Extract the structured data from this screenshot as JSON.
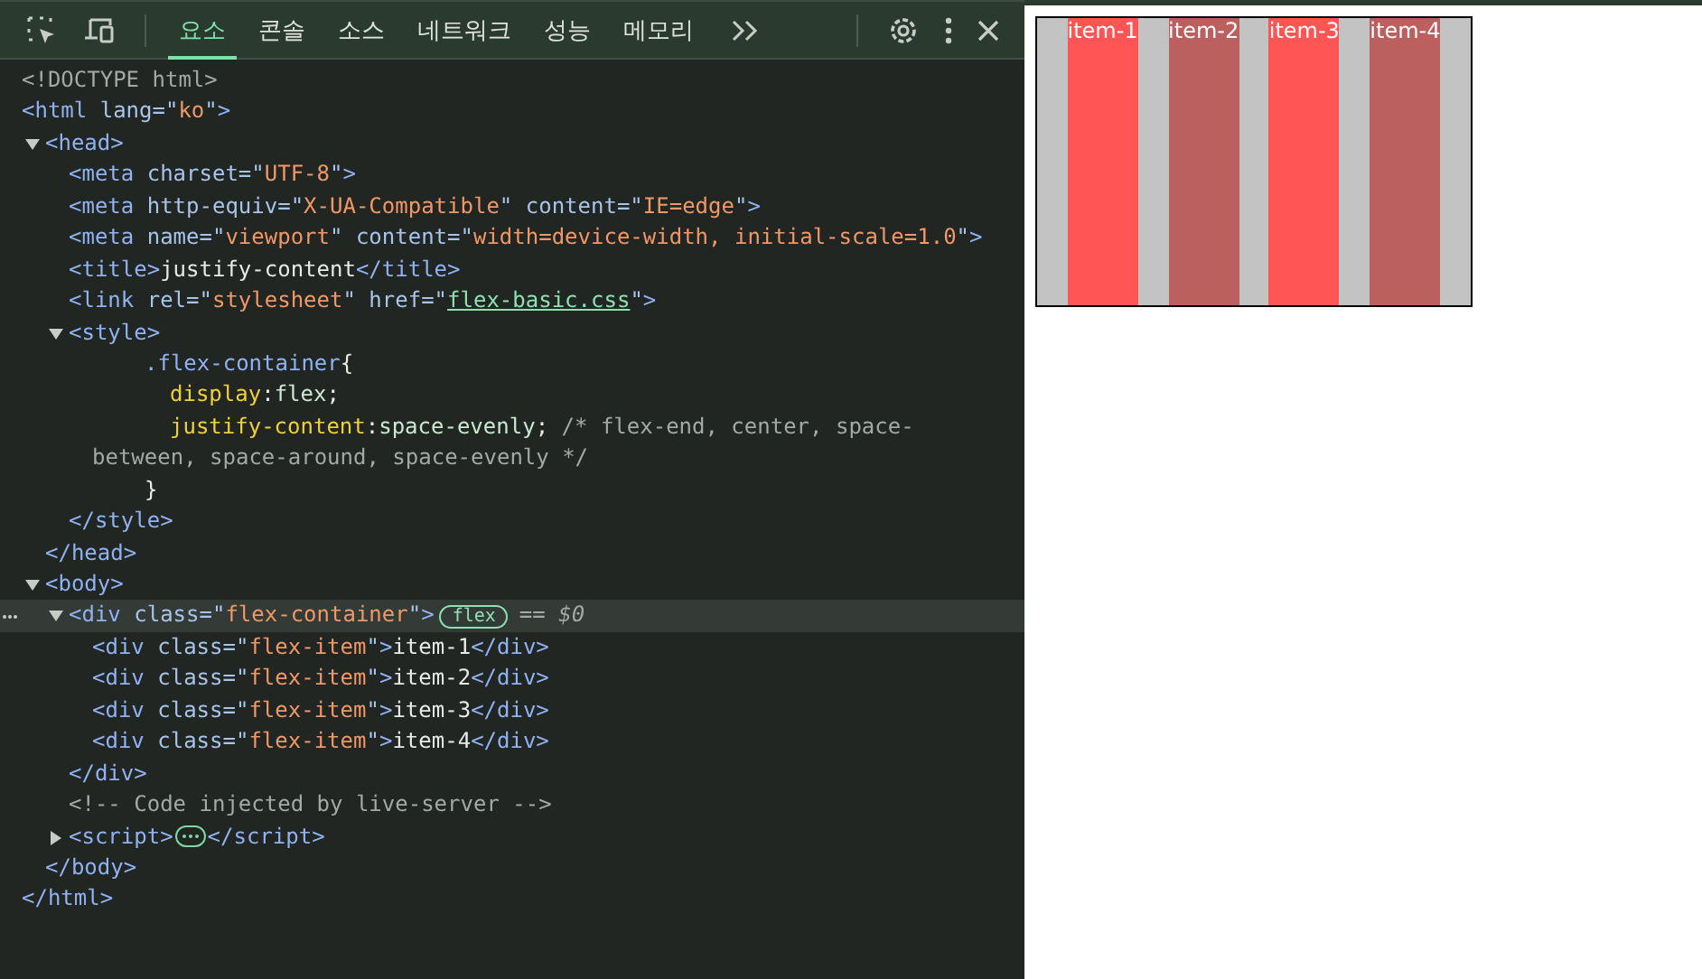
{
  "toolbar": {
    "tabs": [
      {
        "label": "요소",
        "selected": true
      },
      {
        "label": "콘솔",
        "selected": false
      },
      {
        "label": "소스",
        "selected": false
      },
      {
        "label": "네트워크",
        "selected": false
      },
      {
        "label": "성능",
        "selected": false
      },
      {
        "label": "메모리",
        "selected": false
      }
    ]
  },
  "tree": [
    {
      "selected": false,
      "tokens": [
        {
          "kind": "comment",
          "text": "<!DOCTYPE html>"
        }
      ]
    },
    {
      "selected": false,
      "tokens": [
        {
          "kind": "tag",
          "text": "<html"
        },
        {
          "kind": "attr",
          "text": " lang=\""
        },
        {
          "kind": "val",
          "text": "ko"
        },
        {
          "kind": "attr",
          "text": "\""
        },
        {
          "kind": "tag",
          "text": ">"
        }
      ],
      "children": [
        {
          "selected": false,
          "expanded": true,
          "tokens": [
            {
              "kind": "tag",
              "text": "<head>"
            }
          ],
          "children": [
            {
              "selected": false,
              "tokens": [
                {
                  "kind": "tag",
                  "text": "<meta"
                },
                {
                  "kind": "attr",
                  "text": " charset=\""
                },
                {
                  "kind": "val",
                  "text": "UTF-8"
                },
                {
                  "kind": "attr",
                  "text": "\""
                },
                {
                  "kind": "tag",
                  "text": ">"
                }
              ]
            },
            {
              "selected": false,
              "tokens": [
                {
                  "kind": "tag",
                  "text": "<meta"
                },
                {
                  "kind": "attr",
                  "text": " http-equiv=\""
                },
                {
                  "kind": "val",
                  "text": "X-UA-Compatible"
                },
                {
                  "kind": "attr",
                  "text": "\" content=\""
                },
                {
                  "kind": "val",
                  "text": "IE=edge"
                },
                {
                  "kind": "attr",
                  "text": "\""
                },
                {
                  "kind": "tag",
                  "text": ">"
                }
              ]
            },
            {
              "selected": false,
              "tokens": [
                {
                  "kind": "tag",
                  "text": "<meta"
                },
                {
                  "kind": "attr",
                  "text": " name=\""
                },
                {
                  "kind": "val",
                  "text": "viewport"
                },
                {
                  "kind": "attr",
                  "text": "\" content=\""
                },
                {
                  "kind": "val",
                  "text": "width=device-width, initial-scale=1.0"
                },
                {
                  "kind": "attr",
                  "text": "\""
                },
                {
                  "kind": "tag",
                  "text": ">"
                }
              ]
            },
            {
              "selected": false,
              "tokens": [
                {
                  "kind": "tag",
                  "text": "<title>"
                },
                {
                  "kind": "text",
                  "text": "justify-content"
                },
                {
                  "kind": "tag",
                  "text": "</title>"
                }
              ]
            },
            {
              "selected": false,
              "tokens": [
                {
                  "kind": "tag",
                  "text": "<link"
                },
                {
                  "kind": "attr",
                  "text": " rel=\""
                },
                {
                  "kind": "val",
                  "text": "stylesheet"
                },
                {
                  "kind": "attr",
                  "text": "\" href=\""
                },
                {
                  "kind": "link",
                  "text": "flex-basic.css"
                },
                {
                  "kind": "attr",
                  "text": "\""
                },
                {
                  "kind": "tag",
                  "text": ">"
                }
              ]
            },
            {
              "selected": false,
              "expanded": true,
              "tokens": [
                {
                  "kind": "tag",
                  "text": "<style>"
                }
              ],
              "children": [
                {
                  "selected": false,
                  "kind": "css-open",
                  "tokens": [
                    {
                      "kind": "selector",
                      "text": ".flex-container"
                    },
                    {
                      "kind": "text",
                      "text": "{"
                    }
                  ]
                },
                {
                  "selected": false,
                  "kind": "css-decl",
                  "tokens": [
                    {
                      "kind": "prop",
                      "text": "display"
                    },
                    {
                      "kind": "text",
                      "text": ":"
                    },
                    {
                      "kind": "cssval",
                      "text": "flex"
                    },
                    {
                      "kind": "text",
                      "text": ";"
                    }
                  ]
                },
                {
                  "selected": false,
                  "kind": "css-decl",
                  "tokens": [
                    {
                      "kind": "prop",
                      "text": "justify-content"
                    },
                    {
                      "kind": "text",
                      "text": ":"
                    },
                    {
                      "kind": "cssval",
                      "text": "space-evenly"
                    },
                    {
                      "kind": "text",
                      "text": "; "
                    },
                    {
                      "kind": "comment",
                      "text": "/* flex-end, center, space-"
                    }
                  ]
                },
                {
                  "selected": false,
                  "kind": "css-wrap",
                  "tokens": [
                    {
                      "kind": "comment",
                      "text": "between, space-around, space-evenly */"
                    }
                  ]
                },
                {
                  "selected": false,
                  "kind": "css-close",
                  "tokens": [
                    {
                      "kind": "text",
                      "text": "}"
                    }
                  ]
                }
              ]
            },
            {
              "selected": false,
              "tokens": [
                {
                  "kind": "tag",
                  "text": "</style>"
                }
              ]
            }
          ]
        },
        {
          "selected": false,
          "tokens": [
            {
              "kind": "tag",
              "text": "</head>"
            }
          ]
        },
        {
          "selected": false,
          "expanded": true,
          "tokens": [
            {
              "kind": "tag",
              "text": "<body>"
            }
          ],
          "children": [
            {
              "selected": true,
              "expanded": true,
              "badge": "flex",
              "tokens": [
                {
                  "kind": "tag",
                  "text": "<div"
                },
                {
                  "kind": "attr",
                  "text": " class=\""
                },
                {
                  "kind": "val",
                  "text": "flex-container"
                },
                {
                  "kind": "attr",
                  "text": "\""
                },
                {
                  "kind": "tag",
                  "text": ">"
                }
              ],
              "suffix": "== $0",
              "children": [
                {
                  "selected": false,
                  "tokens": [
                    {
                      "kind": "tag",
                      "text": "<div"
                    },
                    {
                      "kind": "attr",
                      "text": " class=\""
                    },
                    {
                      "kind": "val",
                      "text": "flex-item"
                    },
                    {
                      "kind": "attr",
                      "text": "\""
                    },
                    {
                      "kind": "tag",
                      "text": ">"
                    },
                    {
                      "kind": "text",
                      "text": "item-1"
                    },
                    {
                      "kind": "tag",
                      "text": "</div>"
                    }
                  ]
                },
                {
                  "selected": false,
                  "tokens": [
                    {
                      "kind": "tag",
                      "text": "<div"
                    },
                    {
                      "kind": "attr",
                      "text": " class=\""
                    },
                    {
                      "kind": "val",
                      "text": "flex-item"
                    },
                    {
                      "kind": "attr",
                      "text": "\""
                    },
                    {
                      "kind": "tag",
                      "text": ">"
                    },
                    {
                      "kind": "text",
                      "text": "item-2"
                    },
                    {
                      "kind": "tag",
                      "text": "</div>"
                    }
                  ]
                },
                {
                  "selected": false,
                  "tokens": [
                    {
                      "kind": "tag",
                      "text": "<div"
                    },
                    {
                      "kind": "attr",
                      "text": " class=\""
                    },
                    {
                      "kind": "val",
                      "text": "flex-item"
                    },
                    {
                      "kind": "attr",
                      "text": "\""
                    },
                    {
                      "kind": "tag",
                      "text": ">"
                    },
                    {
                      "kind": "text",
                      "text": "item-3"
                    },
                    {
                      "kind": "tag",
                      "text": "</div>"
                    }
                  ]
                },
                {
                  "selected": false,
                  "tokens": [
                    {
                      "kind": "tag",
                      "text": "<div"
                    },
                    {
                      "kind": "attr",
                      "text": " class=\""
                    },
                    {
                      "kind": "val",
                      "text": "flex-item"
                    },
                    {
                      "kind": "attr",
                      "text": "\""
                    },
                    {
                      "kind": "tag",
                      "text": ">"
                    },
                    {
                      "kind": "text",
                      "text": "item-4"
                    },
                    {
                      "kind": "tag",
                      "text": "</div>"
                    }
                  ]
                }
              ]
            },
            {
              "selected": false,
              "tokens": [
                {
                  "kind": "tag",
                  "text": "</div>"
                }
              ]
            },
            {
              "selected": false,
              "tokens": [
                {
                  "kind": "comment",
                  "text": "<!-- Code injected by live-server -->"
                }
              ]
            },
            {
              "selected": false,
              "expanded": false,
              "collapsed_content": true,
              "tokens": [
                {
                  "kind": "tag",
                  "text": "<script>"
                }
              ],
              "after": [
                {
                  "kind": "tag",
                  "text": "</script>"
                }
              ]
            }
          ]
        },
        {
          "selected": false,
          "tokens": [
            {
              "kind": "tag",
              "text": "</body>"
            }
          ]
        }
      ]
    },
    {
      "selected": false,
      "tokens": [
        {
          "kind": "tag",
          "text": "</html>"
        }
      ]
    }
  ],
  "preview": {
    "items": [
      {
        "label": "item-1",
        "color": "#ff5555"
      },
      {
        "label": "item-2",
        "color": "#bb5f5f"
      },
      {
        "label": "item-3",
        "color": "#ff5555"
      },
      {
        "label": "item-4",
        "color": "#bb5f5f"
      }
    ]
  }
}
